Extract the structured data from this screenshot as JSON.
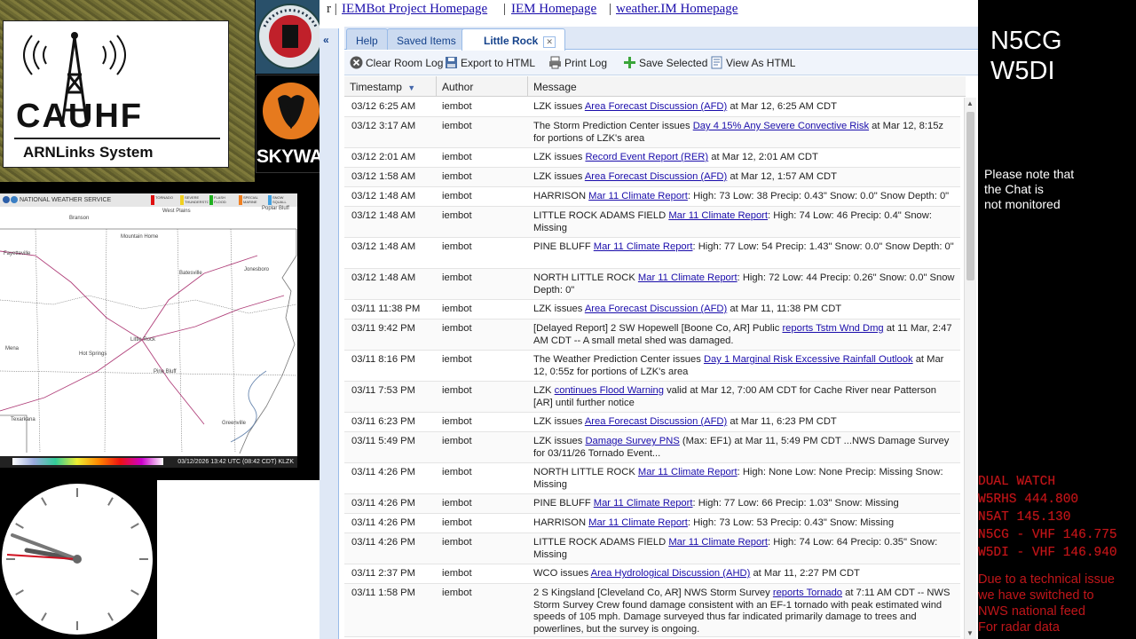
{
  "logos": {
    "cauhf_title": "CAUHF",
    "cauhf_subtitle": "ARNLinks System",
    "skywarn": "SKYWARN"
  },
  "radar": {
    "agency": "NATIONAL WEATHER SERVICE",
    "legend": [
      "TORNADO",
      "SEVERE THUNDERSTORM",
      "FLASH FLOOD",
      "SPECIAL MARINE",
      "SNOW SQUALL"
    ],
    "timestamp": "03/12/2026 13:42 UTC (08:42 CDT) KLZK",
    "places": [
      "West Plains",
      "Branson",
      "Poplar Bluff",
      "Mountain Home",
      "Fayetteville",
      "Jonesboro",
      "Batesville",
      "Little Rock",
      "Hot Springs",
      "Mena",
      "Pine Bluff",
      "Texarkana",
      "Greenville"
    ]
  },
  "chat": {
    "links": [
      "IEMBot Project Homepage",
      "IEM Homepage",
      "weather.IM Homepage"
    ],
    "tabs": [
      "Help",
      "Saved Items",
      "Little Rock"
    ],
    "toolbar": {
      "clear": "Clear Room Log",
      "export": "Export to HTML",
      "print": "Print Log",
      "save": "Save Selected",
      "view": "View As HTML"
    },
    "columns": [
      "Timestamp",
      "Author",
      "Message"
    ],
    "rows": [
      {
        "ts": "03/12 6:25 AM",
        "author": "iembot",
        "pre": "LZK issues ",
        "link": "Area Forecast Discussion (AFD)",
        "post": " at Mar 12, 6:25 AM CDT"
      },
      {
        "ts": "03/12 3:17 AM",
        "author": "iembot",
        "pre": "The Storm Prediction Center issues ",
        "link": "Day 4 15% Any Severe Convective Risk",
        "post": " at Mar 12, 8:15z for portions of LZK's area"
      },
      {
        "ts": "03/12 2:01 AM",
        "author": "iembot",
        "pre": "LZK issues ",
        "link": "Record Event Report (RER)",
        "post": " at Mar 12, 2:01 AM CDT"
      },
      {
        "ts": "03/12 1:58 AM",
        "author": "iembot",
        "pre": "LZK issues ",
        "link": "Area Forecast Discussion (AFD)",
        "post": " at Mar 12, 1:57 AM CDT"
      },
      {
        "ts": "03/12 1:48 AM",
        "author": "iembot",
        "pre": "HARRISON ",
        "link": "Mar 11 Climate Report",
        "post": ": High: 73 Low: 38 Precip: 0.43\" Snow: 0.0\" Snow Depth: 0\""
      },
      {
        "ts": "03/12 1:48 AM",
        "author": "iembot",
        "pre": "LITTLE ROCK ADAMS FIELD ",
        "link": "Mar 11 Climate Report",
        "post": ": High: 74 Low: 46 Precip: 0.4\" Snow: Missing"
      },
      {
        "ts": "03/12 1:48 AM",
        "author": "iembot",
        "pre": "PINE BLUFF ",
        "link": "Mar 11 Climate Report",
        "post": ": High: 77 Low: 54 Precip: 1.43\" Snow: 0.0\" Snow Depth: 0\""
      },
      {
        "ts": "03/12 1:48 AM",
        "author": "iembot",
        "pre": "NORTH LITTLE ROCK ",
        "link": "Mar 11 Climate Report",
        "post": ": High: 72 Low: 44 Precip: 0.26\" Snow: 0.0\" Snow Depth: 0\""
      },
      {
        "ts": "03/11 11:38 PM",
        "author": "iembot",
        "pre": "LZK issues ",
        "link": "Area Forecast Discussion (AFD)",
        "post": " at Mar 11, 11:38 PM CDT"
      },
      {
        "ts": "03/11 9:42 PM",
        "author": "iembot",
        "pre": "[Delayed Report] 2 SW Hopewell [Boone Co, AR] Public ",
        "link": "reports Tstm Wnd Dmg",
        "post": " at 11 Mar, 2:47 AM CDT -- A small metal shed was damaged."
      },
      {
        "ts": "03/11 8:16 PM",
        "author": "iembot",
        "pre": "The Weather Prediction Center issues ",
        "link": "Day 1 Marginal Risk Excessive Rainfall Outlook",
        "post": " at Mar 12, 0:55z for portions of LZK's area"
      },
      {
        "ts": "03/11 7:53 PM",
        "author": "iembot",
        "pre": "LZK ",
        "link": "continues Flood Warning",
        "post": " valid at Mar 12, 7:00 AM CDT for Cache River near Patterson [AR] until further notice"
      },
      {
        "ts": "03/11 6:23 PM",
        "author": "iembot",
        "pre": "LZK issues ",
        "link": "Area Forecast Discussion (AFD)",
        "post": " at Mar 11, 6:23 PM CDT"
      },
      {
        "ts": "03/11 5:49 PM",
        "author": "iembot",
        "pre": "LZK issues ",
        "link": "Damage Survey PNS",
        "post": " (Max: EF1) at Mar 11, 5:49 PM CDT ...NWS Damage Survey for 03/11/26 Tornado Event..."
      },
      {
        "ts": "03/11 4:26 PM",
        "author": "iembot",
        "pre": "NORTH LITTLE ROCK ",
        "link": "Mar 11 Climate Report",
        "post": ": High: None Low: None Precip: Missing Snow: Missing"
      },
      {
        "ts": "03/11 4:26 PM",
        "author": "iembot",
        "pre": "PINE BLUFF ",
        "link": "Mar 11 Climate Report",
        "post": ": High: 77 Low: 66 Precip: 1.03\" Snow: Missing"
      },
      {
        "ts": "03/11 4:26 PM",
        "author": "iembot",
        "pre": "HARRISON ",
        "link": "Mar 11 Climate Report",
        "post": ": High: 73 Low: 53 Precip: 0.43\" Snow: Missing"
      },
      {
        "ts": "03/11 4:26 PM",
        "author": "iembot",
        "pre": "LITTLE ROCK ADAMS FIELD ",
        "link": "Mar 11 Climate Report",
        "post": ": High: 74 Low: 64 Precip: 0.35\" Snow: Missing"
      },
      {
        "ts": "03/11 2:37 PM",
        "author": "iembot",
        "pre": "WCO issues ",
        "link": "Area Hydrological Discussion (AHD)",
        "post": " at Mar 11, 2:27 PM CDT"
      },
      {
        "ts": "03/11 1:58 PM",
        "author": "iembot",
        "pre": "2 S Kingsland [Cleveland Co, AR] NWS Storm Survey ",
        "link": "reports Tornado",
        "post": " at 7:11 AM CDT -- NWS Storm Survey Crew found damage consistent with an EF-1 tornado with peak estimated wind speeds of 105 mph. Damage surveyed thus far indicated primarily damage to trees and powerlines, but the survey is ongoing."
      }
    ]
  },
  "right": {
    "callsign_1": "N5CG",
    "callsign_2": "W5DI",
    "note": "Please note that\n the Chat is\nnot monitored",
    "freq_lines": [
      "DUAL WATCH",
      "W5RHS  444.800",
      "N5AT  145.130",
      "N5CG - VHF 146.775",
      "W5DI  - VHF 146.940"
    ],
    "notice_lines": [
      "Due to a technical issue",
      "we have switched to",
      "NWS national feed",
      "For radar data"
    ]
  },
  "colors": {
    "link": "#1a0dab",
    "alert_red": "#c0161a",
    "ext_header": "#dfe8f6"
  }
}
